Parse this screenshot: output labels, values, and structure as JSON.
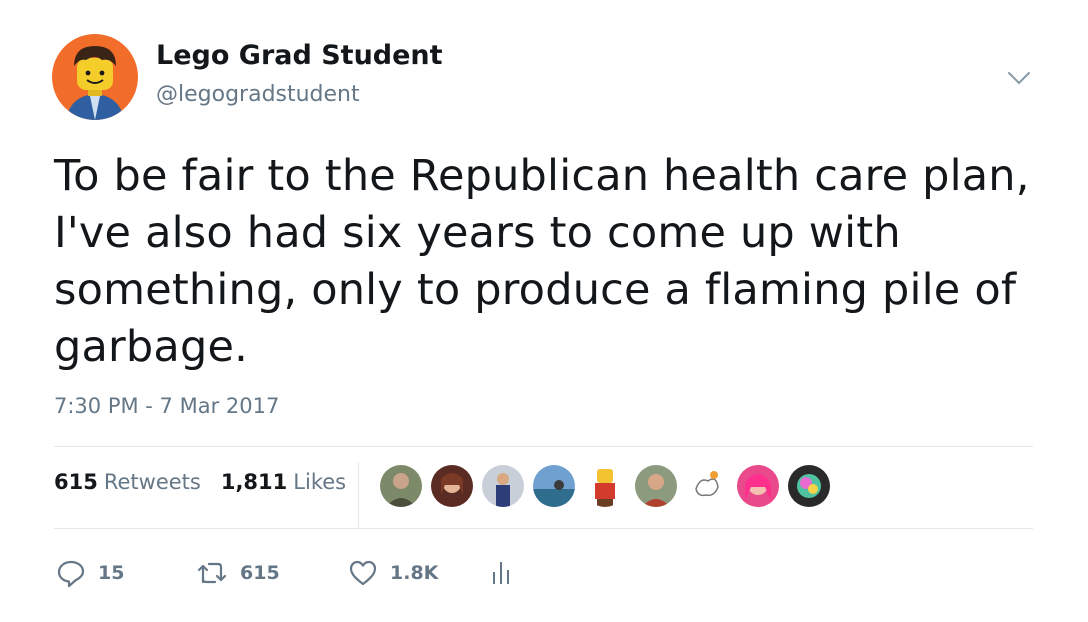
{
  "author": {
    "name": "Lego Grad Student",
    "handle": "@legogradstudent"
  },
  "tweet": {
    "text": "To be fair to the Republican health care plan, I've also had six years to come up with something, only to produce a flaming pile of garbage.",
    "timestamp": "7:30 PM - 7 Mar 2017"
  },
  "stats": {
    "retweets_count": "615",
    "retweets_label": "Retweets",
    "likes_count": "1,811",
    "likes_label": "Likes"
  },
  "actions": {
    "reply_count": "15",
    "retweet_count": "615",
    "like_count": "1.8K"
  },
  "colors": {
    "text": "#14171a",
    "secondary": "#657786",
    "divider": "#e1e8ed",
    "avatar_background": "#f26c2a"
  },
  "icons": [
    "reply-icon",
    "retweet-icon",
    "like-icon",
    "analytics-icon",
    "chevron-down-icon"
  ]
}
